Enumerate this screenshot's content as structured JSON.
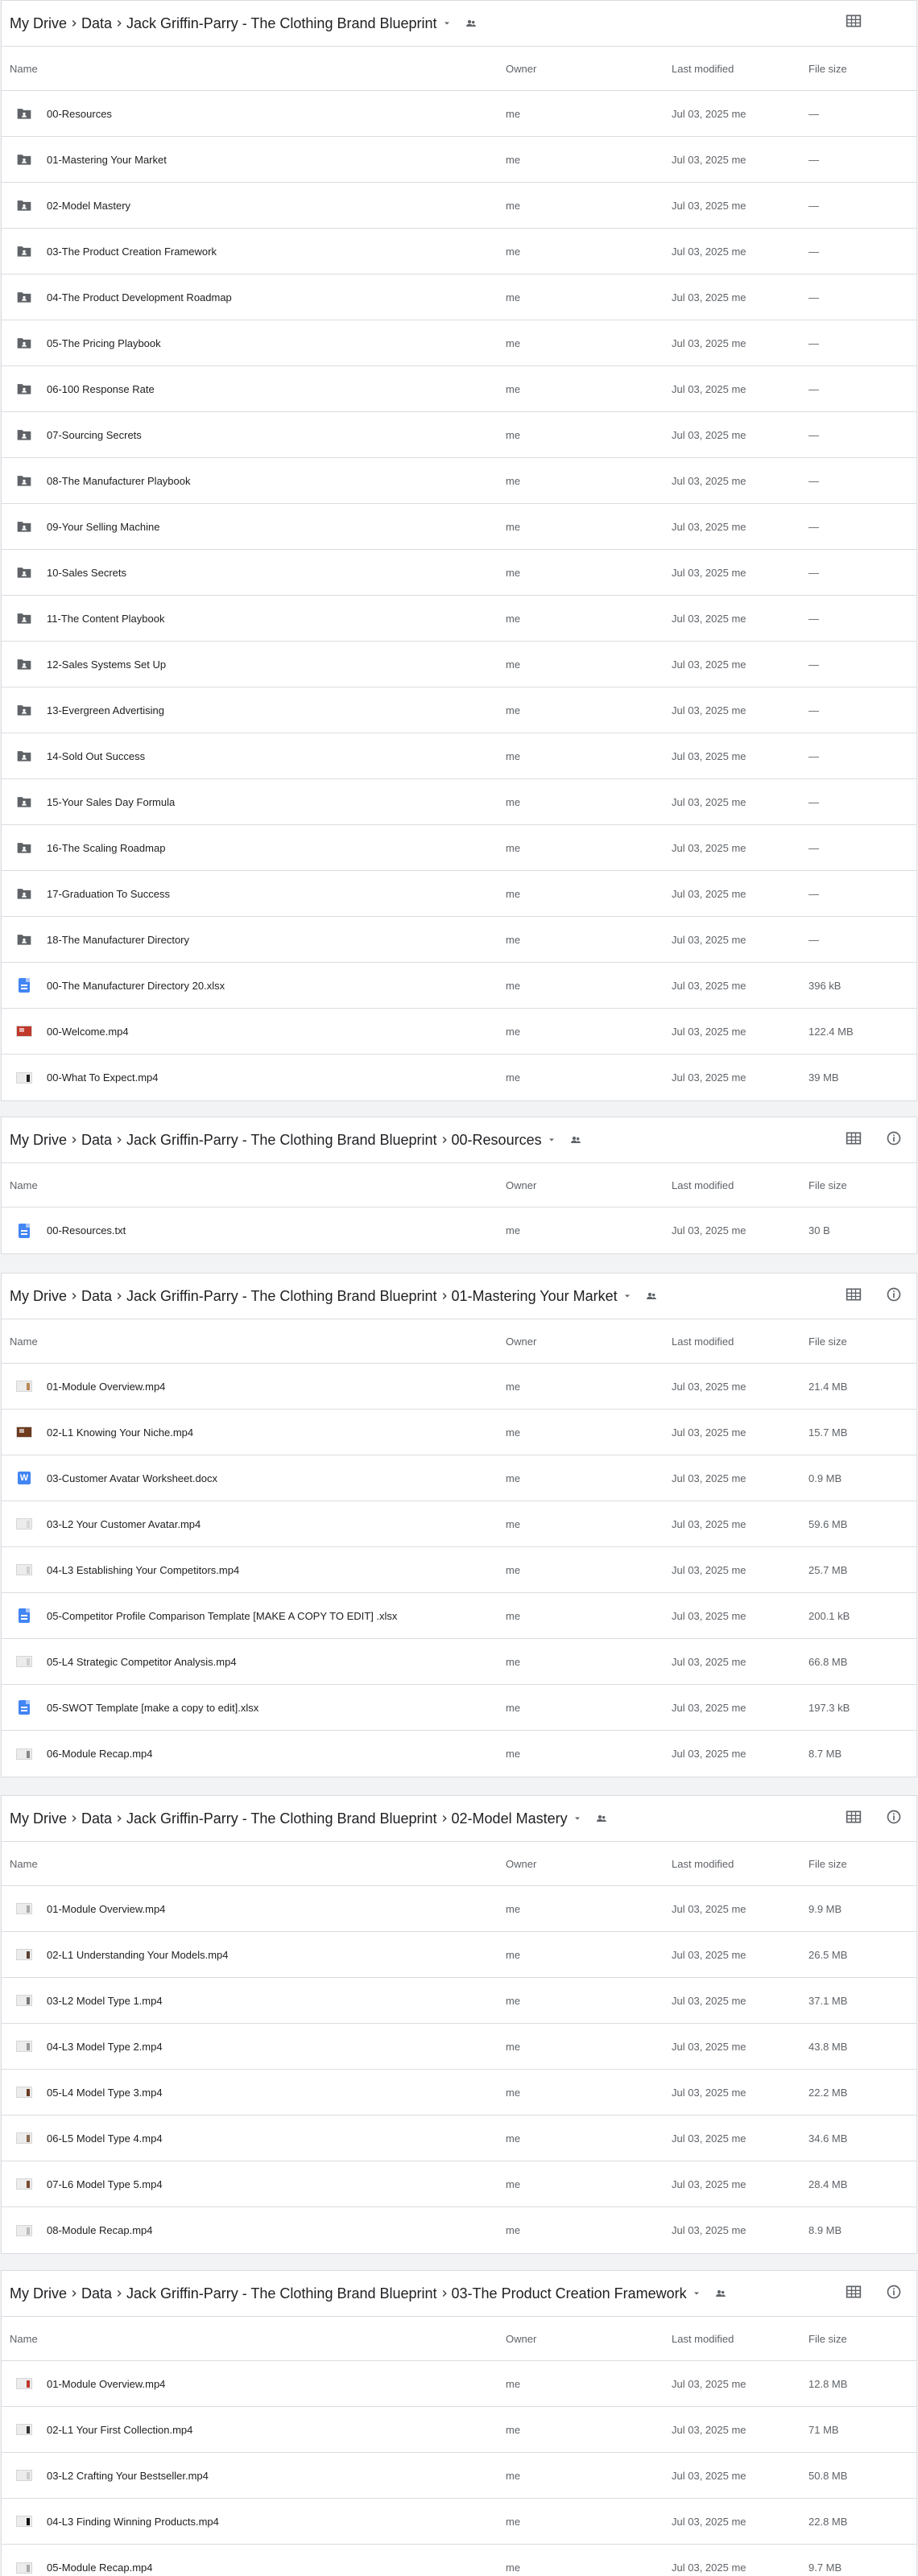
{
  "owner_default": "me",
  "modified_default": "Jul 03, 2025 me",
  "columns": {
    "name": "Name",
    "owner": "Owner",
    "modified": "Last modified",
    "size": "File size"
  },
  "icons": {
    "folder": "shared-folder-icon",
    "sheet": "doc-icon",
    "text": "doc-icon",
    "word": "word-doc-icon",
    "video": "video-thumbnail-icon",
    "grid": "grid-view-icon",
    "info": "info-icon",
    "shared": "people-icon",
    "dropdown": "dropdown-arrow-icon",
    "chevron": "chevron-right-icon"
  },
  "colors": {
    "doc_blue": "#4285f4",
    "folder_gray": "#5f6368",
    "border": "#dadce0"
  },
  "panels": [
    {
      "breadcrumb": [
        "My Drive",
        "Data",
        "Jack Griffin-Parry - The Clothing Brand Blueprint"
      ],
      "show_info": false,
      "rows": [
        {
          "name": "00-Resources",
          "type": "folder",
          "size": "—"
        },
        {
          "name": "01-Mastering Your Market",
          "type": "folder",
          "size": "—"
        },
        {
          "name": "02-Model Mastery",
          "type": "folder",
          "size": "—"
        },
        {
          "name": "03-The Product Creation Framework",
          "type": "folder",
          "size": "—"
        },
        {
          "name": "04-The Product Development Roadmap",
          "type": "folder",
          "size": "—"
        },
        {
          "name": "05-The Pricing Playbook",
          "type": "folder",
          "size": "—"
        },
        {
          "name": "06-100 Response Rate",
          "type": "folder",
          "size": "—"
        },
        {
          "name": "07-Sourcing Secrets",
          "type": "folder",
          "size": "—"
        },
        {
          "name": "08-The Manufacturer Playbook",
          "type": "folder",
          "size": "—"
        },
        {
          "name": "09-Your Selling Machine",
          "type": "folder",
          "size": "—"
        },
        {
          "name": "10-Sales Secrets",
          "type": "folder",
          "size": "—"
        },
        {
          "name": "11-The Content Playbook",
          "type": "folder",
          "size": "—"
        },
        {
          "name": "12-Sales Systems Set Up",
          "type": "folder",
          "size": "—"
        },
        {
          "name": "13-Evergreen Advertising",
          "type": "folder",
          "size": "—"
        },
        {
          "name": "14-Sold Out Success",
          "type": "folder",
          "size": "—"
        },
        {
          "name": "15-Your Sales Day Formula",
          "type": "folder",
          "size": "—"
        },
        {
          "name": "16-The Scaling Roadmap",
          "type": "folder",
          "size": "—"
        },
        {
          "name": "17-Graduation To Success",
          "type": "folder",
          "size": "—"
        },
        {
          "name": "18-The Manufacturer Directory",
          "type": "folder",
          "size": "—"
        },
        {
          "name": "00-The Manufacturer Directory 20.xlsx",
          "type": "sheet",
          "size": "396 kB"
        },
        {
          "name": "00-Welcome.mp4",
          "type": "video",
          "thumb": "#c0392b",
          "full": true,
          "size": "122.4 MB"
        },
        {
          "name": "00-What To Expect.mp4",
          "type": "video",
          "thumb": "#222222",
          "size": "39 MB"
        }
      ]
    },
    {
      "breadcrumb": [
        "My Drive",
        "Data",
        "Jack Griffin-Parry - The Clothing Brand Blueprint",
        "00-Resources"
      ],
      "show_info": true,
      "rows": [
        {
          "name": "00-Resources.txt",
          "type": "text",
          "size": "30 B"
        }
      ]
    },
    {
      "breadcrumb": [
        "My Drive",
        "Data",
        "Jack Griffin-Parry - The Clothing Brand Blueprint",
        "01-Mastering Your Market"
      ],
      "show_info": true,
      "rows": [
        {
          "name": "01-Module Overview.mp4",
          "type": "video",
          "thumb": "#b98a5a",
          "size": "21.4 MB"
        },
        {
          "name": "02-L1 Knowing Your Niche.mp4",
          "type": "video",
          "thumb": "#6d3b1f",
          "full": true,
          "size": "15.7 MB"
        },
        {
          "name": "03-Customer Avatar Worksheet.docx",
          "type": "word",
          "size": "0.9 MB"
        },
        {
          "name": "03-L2 Your Customer Avatar.mp4",
          "type": "video",
          "thumb": "#d8d8d8",
          "size": "59.6 MB"
        },
        {
          "name": "04-L3 Establishing Your Competitors.mp4",
          "type": "video",
          "thumb": "#d0d0d0",
          "size": "25.7 MB"
        },
        {
          "name": "05-Competitor Profile Comparison Template [MAKE A COPY TO EDIT] .xlsx",
          "type": "sheet",
          "size": "200.1 kB"
        },
        {
          "name": "05-L4 Strategic Competitor Analysis.mp4",
          "type": "video",
          "thumb": "#d0d0d0",
          "size": "66.8 MB"
        },
        {
          "name": "05-SWOT Template [make a copy to edit].xlsx",
          "type": "sheet",
          "size": "197.3 kB"
        },
        {
          "name": "06-Module Recap.mp4",
          "type": "video",
          "thumb": "#888888",
          "size": "8.7 MB"
        }
      ]
    },
    {
      "breadcrumb": [
        "My Drive",
        "Data",
        "Jack Griffin-Parry - The Clothing Brand Blueprint",
        "02-Model Mastery"
      ],
      "show_info": true,
      "rows": [
        {
          "name": "01-Module Overview.mp4",
          "type": "video",
          "thumb": "#aaaaaa",
          "size": "9.9 MB"
        },
        {
          "name": "02-L1 Understanding Your Models.mp4",
          "type": "video",
          "thumb": "#5a4030",
          "size": "26.5 MB"
        },
        {
          "name": "03-L2 Model Type 1.mp4",
          "type": "video",
          "thumb": "#777777",
          "size": "37.1 MB"
        },
        {
          "name": "04-L3 Model Type 2.mp4",
          "type": "video",
          "thumb": "#999999",
          "size": "43.8 MB"
        },
        {
          "name": "05-L4 Model Type 3.mp4",
          "type": "video",
          "thumb": "#6a3a20",
          "size": "22.2 MB"
        },
        {
          "name": "06-L5 Model Type 4.mp4",
          "type": "video",
          "thumb": "#8a6a50",
          "size": "34.6 MB"
        },
        {
          "name": "07-L6 Model Type 5.mp4",
          "type": "video",
          "thumb": "#7a4a30",
          "size": "28.4 MB"
        },
        {
          "name": "08-Module Recap.mp4",
          "type": "video",
          "thumb": "#bbbbbb",
          "size": "8.9 MB"
        }
      ]
    },
    {
      "breadcrumb": [
        "My Drive",
        "Data",
        "Jack Griffin-Parry - The Clothing Brand Blueprint",
        "03-The Product Creation Framework"
      ],
      "show_info": true,
      "rows": [
        {
          "name": "01-Module Overview.mp4",
          "type": "video",
          "thumb": "#c0392b",
          "size": "12.8 MB"
        },
        {
          "name": "02-L1 Your First Collection.mp4",
          "type": "video",
          "thumb": "#333333",
          "size": "71 MB"
        },
        {
          "name": "03-L2 Crafting Your Bestseller.mp4",
          "type": "video",
          "thumb": "#cccccc",
          "size": "50.8 MB"
        },
        {
          "name": "04-L3 Finding Winning Products.mp4",
          "type": "video",
          "thumb": "#111111",
          "size": "22.8 MB"
        },
        {
          "name": "05-Module Recap.mp4",
          "type": "video",
          "thumb": "#aaaaaa",
          "size": "9.7 MB"
        }
      ]
    }
  ]
}
